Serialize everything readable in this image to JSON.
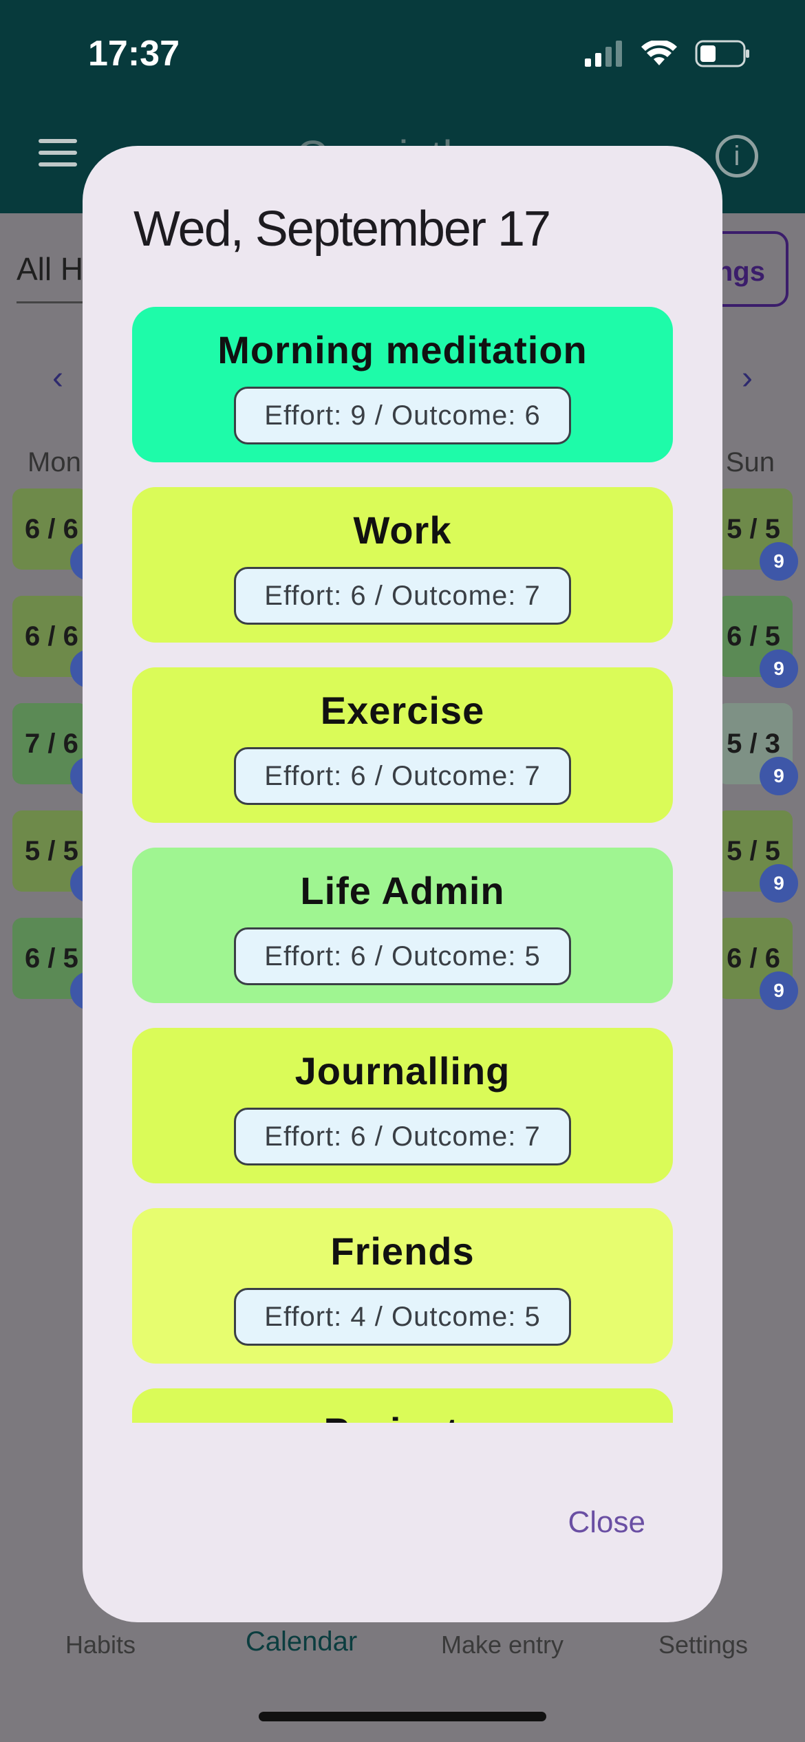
{
  "status_bar": {
    "time": "17:37",
    "icons": [
      "signal-icon",
      "wifi-icon",
      "battery-icon"
    ]
  },
  "app_bar": {
    "title": "Consistly",
    "menu_icon": "hamburger-menu-icon",
    "info_icon": "info-icon"
  },
  "filter": {
    "label": "All H",
    "settings_label": "ngs"
  },
  "calendar": {
    "prev_icon": "chevron-left-icon",
    "next_icon": "chevron-right-icon",
    "day_first": "Mon",
    "day_last": "Sun",
    "left_cells": [
      {
        "value": "6 / 6",
        "color": "#6e8a4a"
      },
      {
        "value": "6 / 6",
        "color": "#6e8a4a"
      },
      {
        "value": "7 / 6",
        "color": "#5b8a55"
      },
      {
        "value": "5 / 5",
        "color": "#6e8a4a"
      },
      {
        "value": "6 / 5",
        "color": "#5b8a55"
      }
    ],
    "right_cells": [
      {
        "value": "5 / 5",
        "badge": "9",
        "color": "#6e8a4a"
      },
      {
        "value": "6 / 5",
        "badge": "9",
        "color": "#5b8a55"
      },
      {
        "value": "5 / 3",
        "badge": "9",
        "color": "#7e9185"
      },
      {
        "value": "5 / 5",
        "badge": "9",
        "color": "#6e8a4a"
      },
      {
        "value": "6 / 6",
        "badge": "9",
        "color": "#6e8a4a"
      }
    ]
  },
  "dialog": {
    "title": "Wed, September 17",
    "habits": [
      {
        "name": "Morning meditation",
        "detail": "Effort: 9 / Outcome: 6",
        "color": "#1efba9"
      },
      {
        "name": "Work",
        "detail": "Effort: 6 / Outcome: 7",
        "color": "#dafb58"
      },
      {
        "name": "Exercise",
        "detail": "Effort: 6 / Outcome: 7",
        "color": "#dafb58"
      },
      {
        "name": "Life Admin",
        "detail": "Effort: 6 / Outcome: 5",
        "color": "#9ff591"
      },
      {
        "name": "Journalling",
        "detail": "Effort: 6 / Outcome: 7",
        "color": "#dafb58"
      },
      {
        "name": "Friends",
        "detail": "Effort: 4 / Outcome: 5",
        "color": "#e7fd6f"
      },
      {
        "name": "Projects",
        "detail": "",
        "color": "#dafb58"
      }
    ],
    "close_label": "Close"
  },
  "bottom_nav": {
    "tabs": [
      {
        "label": "Habits",
        "active": false
      },
      {
        "label": "Calendar",
        "active": true
      },
      {
        "label": "Make entry",
        "active": false
      },
      {
        "label": "Settings",
        "active": false
      }
    ]
  }
}
